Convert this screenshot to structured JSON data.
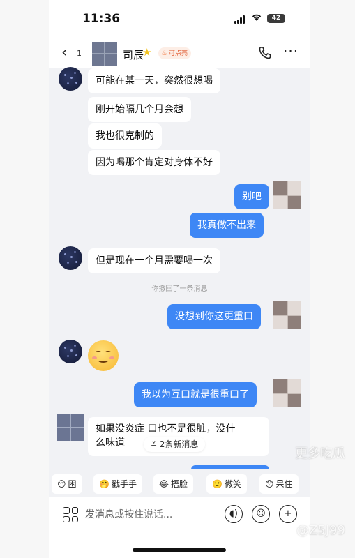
{
  "status_bar": {
    "time": "11:36",
    "battery": "42"
  },
  "header": {
    "unread_count": "1",
    "contact_name": "司辰",
    "badge": "可点亮"
  },
  "messages": {
    "m1": "可能在某一天，突然很想喝",
    "m2": "刚开始隔几个月会想",
    "m3": "我也很克制的",
    "m4": "因为喝那个肯定对身体不好",
    "m5": "别吧",
    "m6": "我真做不出来",
    "m7": "但是现在一个月需要喝一次",
    "recall_note": "你撤回了一条消息",
    "m8": "没想到你这更重口",
    "m9": "我以为互口就是很重口了",
    "m10_line1": "如果没炎症  口也不是很脏，没什",
    "m10_line2": "么味道"
  },
  "new_messages_chip": "2条新消息",
  "quick_replies": [
    {
      "icon": "sleepy-emoji",
      "label": "困"
    },
    {
      "icon": "clapping-emoji",
      "label": "戳手手"
    },
    {
      "icon": "crying-laughing-emoji",
      "label": "捂脸"
    },
    {
      "icon": "smile-emoji",
      "label": "微笑"
    },
    {
      "icon": "dazed-emoji",
      "label": "呆住"
    }
  ],
  "input": {
    "placeholder": "发消息或按住说话..."
  },
  "watermark": {
    "line1": "更多吃瓜",
    "line2": "@Z5J99"
  },
  "colors": {
    "accent": "#3e87f5",
    "background": "#f1f2f5"
  }
}
